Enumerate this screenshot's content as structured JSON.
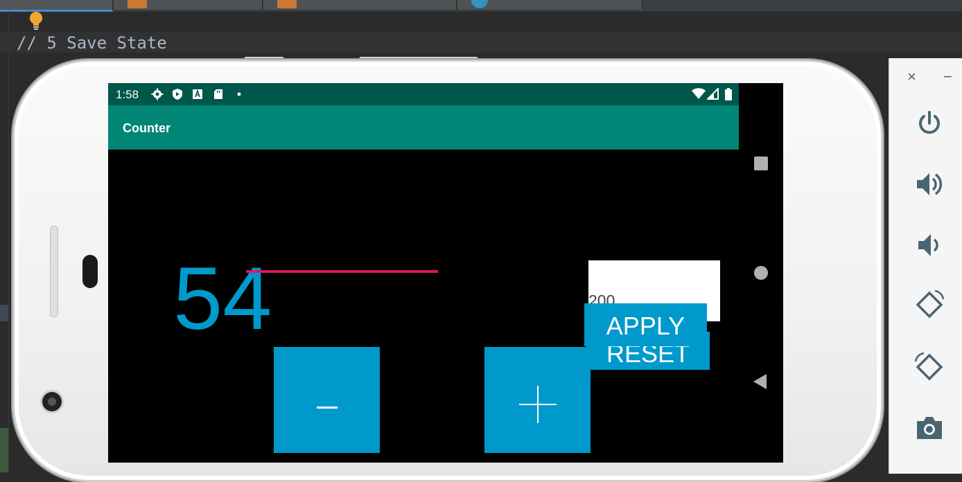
{
  "ide": {
    "code_line": "// 5 Save State",
    "tabs": [
      {
        "icon": "file-icon"
      },
      {
        "icon": "xml-file-icon"
      },
      {
        "icon": "xml-file-icon"
      },
      {
        "icon": "app-icon"
      }
    ]
  },
  "phone": {
    "status": {
      "time": "1:58",
      "icons": [
        "gear-icon",
        "play-protect-icon",
        "font-icon",
        "sd-card-icon",
        "dot-icon"
      ],
      "right_icons": [
        "wifi-icon",
        "signal-icon",
        "battery-icon"
      ]
    },
    "app": {
      "title": "Counter",
      "counter_value": "54",
      "minus_label": "−",
      "plus_label": "+",
      "input_value": "200",
      "apply_label": "APPLY",
      "reset_label": "RESET"
    },
    "nav": [
      "recents-button",
      "home-button",
      "back-button"
    ]
  },
  "emulator": {
    "close_label": "×",
    "minimize_label": "−",
    "controls": [
      "power-icon",
      "volume-up-icon",
      "volume-down-icon",
      "rotate-left-icon",
      "rotate-right-icon",
      "camera-icon"
    ]
  },
  "colors": {
    "status_bar": "#00574b",
    "app_bar": "#008577",
    "accent": "#0099cc",
    "edit_underline": "#d81b60"
  }
}
